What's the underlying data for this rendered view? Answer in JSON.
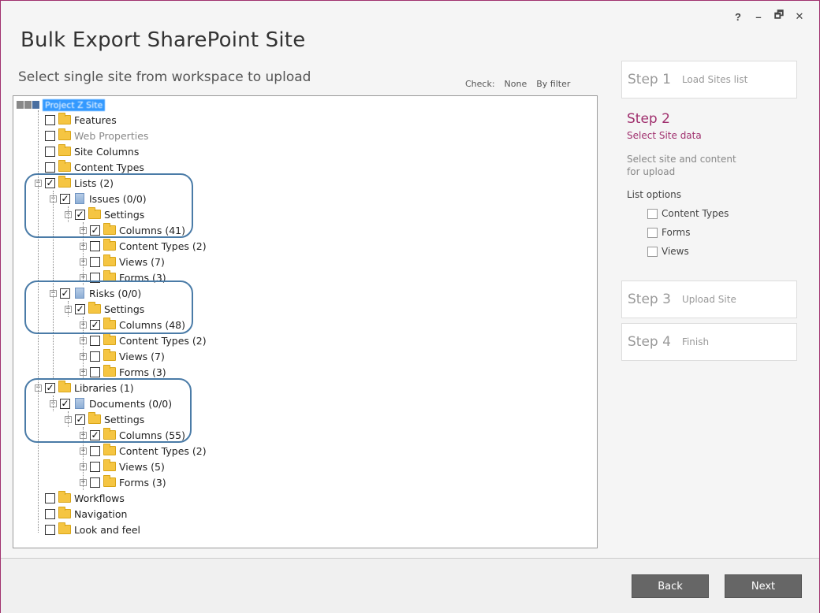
{
  "window": {
    "title": "Bulk Export SharePoint Site",
    "controls": [
      "?",
      "–",
      "🗗",
      "✕"
    ]
  },
  "main": {
    "subtitle": "Select single site from workspace to upload",
    "check_label": "Check:",
    "check_none": "None",
    "check_by_filter": "By filter",
    "root_label": "Project Z Site"
  },
  "tree": [
    {
      "label": "Features",
      "level": 1,
      "checked": false,
      "expander": "none",
      "icon": "folder",
      "grey": false
    },
    {
      "label": "Web Properties",
      "level": 1,
      "checked": false,
      "expander": "none",
      "icon": "folder",
      "grey": true
    },
    {
      "label": "Site Columns",
      "level": 1,
      "checked": false,
      "expander": "none",
      "icon": "folder",
      "grey": false
    },
    {
      "label": "Content Types",
      "level": 1,
      "checked": false,
      "expander": "none",
      "icon": "folder",
      "grey": false
    },
    {
      "label": "Lists (2)",
      "level": 1,
      "checked": true,
      "expander": "minus",
      "icon": "folder",
      "grey": false
    },
    {
      "label": "Issues (0/0)",
      "level": 2,
      "checked": true,
      "expander": "minus",
      "icon": "list",
      "grey": false
    },
    {
      "label": "Settings",
      "level": 3,
      "checked": true,
      "expander": "minus",
      "icon": "folder",
      "grey": false
    },
    {
      "label": "Columns (41)",
      "level": 4,
      "checked": true,
      "expander": "plus",
      "icon": "folder",
      "grey": false
    },
    {
      "label": "Content Types (2)",
      "level": 4,
      "checked": false,
      "expander": "plus",
      "icon": "folder",
      "grey": false
    },
    {
      "label": "Views (7)",
      "level": 4,
      "checked": false,
      "expander": "plus",
      "icon": "folder",
      "grey": false
    },
    {
      "label": "Forms (3)",
      "level": 4,
      "checked": false,
      "expander": "plus",
      "icon": "folder",
      "grey": false
    },
    {
      "label": "Risks (0/0)",
      "level": 2,
      "checked": true,
      "expander": "minus",
      "icon": "list",
      "grey": false
    },
    {
      "label": "Settings",
      "level": 3,
      "checked": true,
      "expander": "minus",
      "icon": "folder",
      "grey": false
    },
    {
      "label": "Columns (48)",
      "level": 4,
      "checked": true,
      "expander": "plus",
      "icon": "folder",
      "grey": false
    },
    {
      "label": "Content Types (2)",
      "level": 4,
      "checked": false,
      "expander": "plus",
      "icon": "folder",
      "grey": false
    },
    {
      "label": "Views (7)",
      "level": 4,
      "checked": false,
      "expander": "plus",
      "icon": "folder",
      "grey": false
    },
    {
      "label": "Forms (3)",
      "level": 4,
      "checked": false,
      "expander": "plus",
      "icon": "folder",
      "grey": false
    },
    {
      "label": "Libraries (1)",
      "level": 1,
      "checked": true,
      "expander": "minus",
      "icon": "folder",
      "grey": false
    },
    {
      "label": "Documents (0/0)",
      "level": 2,
      "checked": true,
      "expander": "minus",
      "icon": "list",
      "grey": false
    },
    {
      "label": "Settings",
      "level": 3,
      "checked": true,
      "expander": "minus",
      "icon": "folder",
      "grey": false
    },
    {
      "label": "Columns (55)",
      "level": 4,
      "checked": true,
      "expander": "plus",
      "icon": "folder",
      "grey": false
    },
    {
      "label": "Content Types (2)",
      "level": 4,
      "checked": false,
      "expander": "plus",
      "icon": "folder",
      "grey": false
    },
    {
      "label": "Views (5)",
      "level": 4,
      "checked": false,
      "expander": "plus",
      "icon": "folder",
      "grey": false
    },
    {
      "label": "Forms (3)",
      "level": 4,
      "checked": false,
      "expander": "plus",
      "icon": "folder",
      "grey": false
    },
    {
      "label": "Workflows",
      "level": 1,
      "checked": false,
      "expander": "none",
      "icon": "folder",
      "grey": false
    },
    {
      "label": "Navigation",
      "level": 1,
      "checked": false,
      "expander": "none",
      "icon": "folder",
      "grey": false
    },
    {
      "label": "Look and feel",
      "level": 1,
      "checked": false,
      "expander": "none",
      "icon": "folder",
      "grey": false
    }
  ],
  "steps": {
    "step1": {
      "num": "Step 1",
      "name": "Load Sites list"
    },
    "step2": {
      "num": "Step 2",
      "name": "Select Site data",
      "desc_line1": "Select site and content",
      "desc_line2": "for upload",
      "options_title": "List options",
      "options": [
        "Content Types",
        "Forms",
        "Views"
      ]
    },
    "step3": {
      "num": "Step 3",
      "name": "Upload Site"
    },
    "step4": {
      "num": "Step 4",
      "name": "Finish"
    }
  },
  "footer": {
    "back_label": "Back",
    "next_label": "Next"
  },
  "colors": {
    "accent": "#a0306e",
    "selection": "#3399ff",
    "highlight_box": "#4a7ba7",
    "button": "#666666"
  }
}
